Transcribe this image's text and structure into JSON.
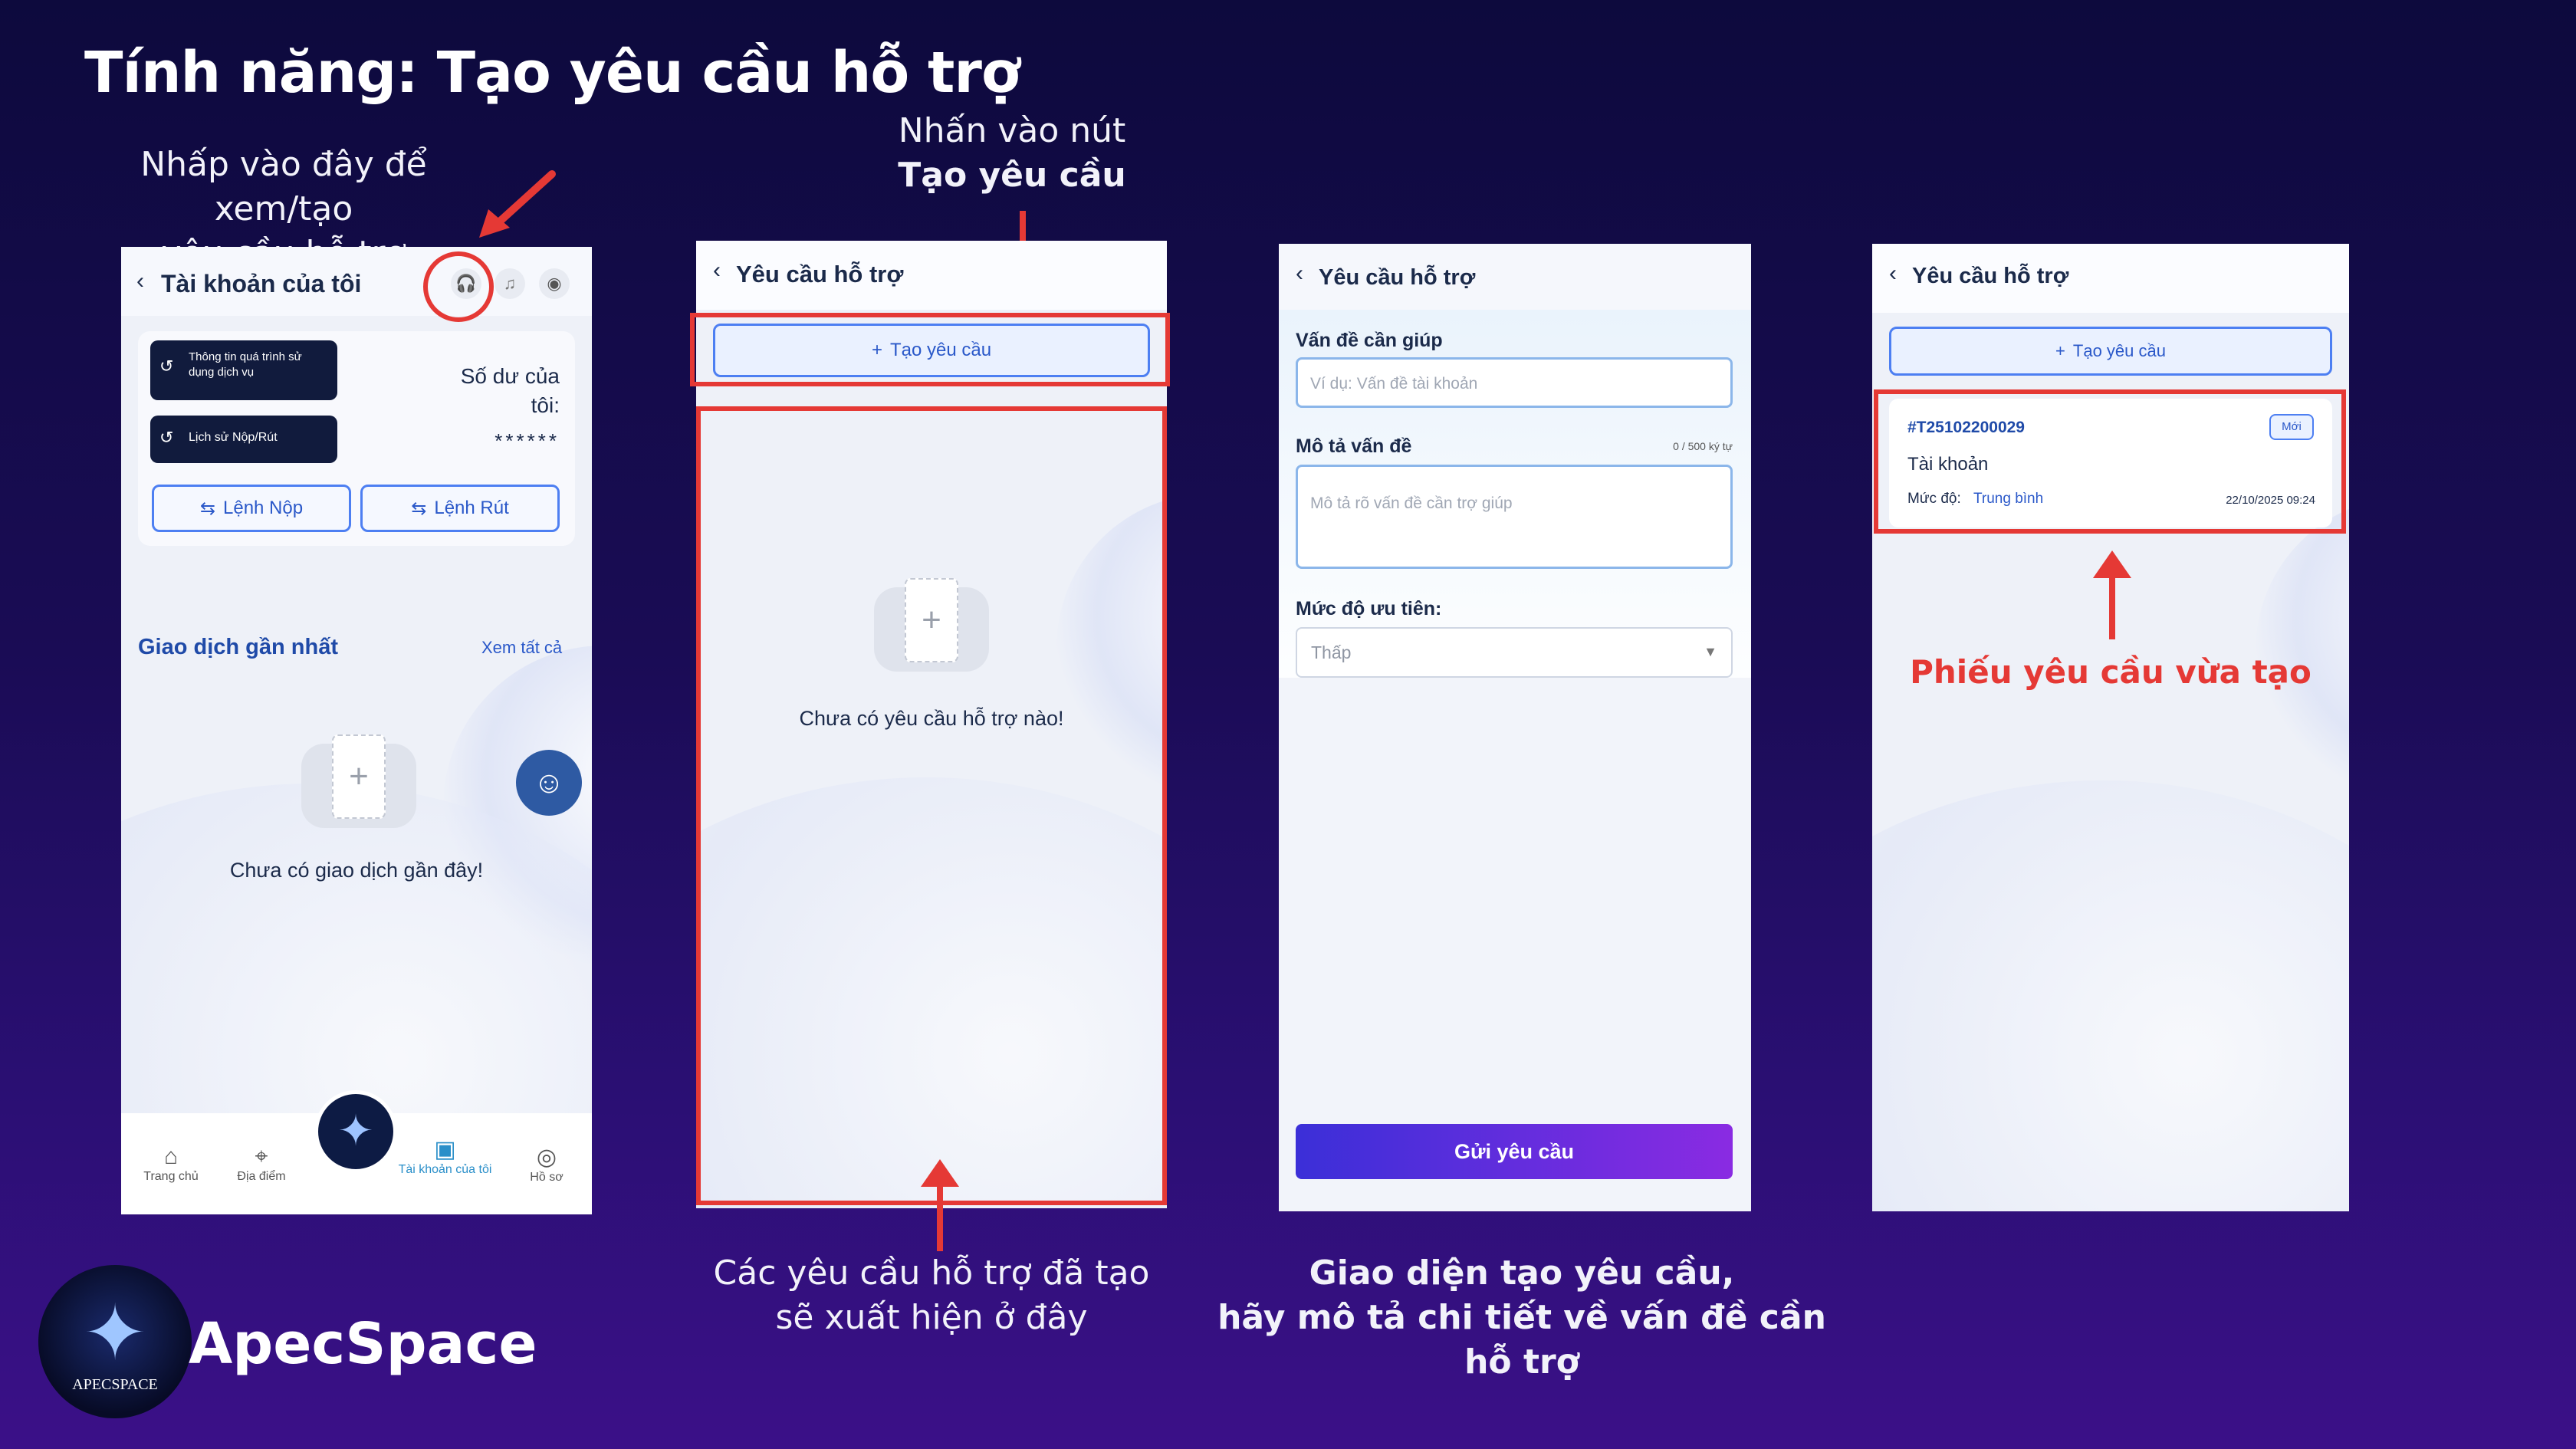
{
  "title": "Tính năng: Tạo yêu cầu hỗ trợ",
  "annotations": {
    "support_hint": [
      "Nhấp vào đây để xem/tạo",
      "yêu cầu hỗ trợ"
    ],
    "create_hint_1": "Nhấn vào nút",
    "create_hint_2": "Tạo yêu cầu",
    "list_hint": [
      "Các yêu cầu hỗ trợ đã tạo",
      "sẽ xuất hiện ở đây"
    ],
    "form_hint": [
      "Giao diện tạo yêu cầu,",
      "hãy mô tả chi tiết về vấn đề cần hỗ trợ"
    ],
    "new_ticket_hint": "Phiếu yêu cầu vừa tạo"
  },
  "brand": {
    "name": "ApecSpace",
    "logo_text": "APECSPACE"
  },
  "screen1": {
    "header": "Tài khoản của tôi",
    "history_btn": "Thông tin quá trình sử dụng dịch vụ",
    "deposit_history_btn": "Lịch sử Nộp/Rút",
    "balance_label": "Số dư của tôi:",
    "balance_value": "******",
    "deposit_btn": "Lệnh Nộp",
    "withdraw_btn": "Lệnh Rút",
    "recent_title": "Giao dịch gần nhất",
    "see_all": "Xem tất cả",
    "empty_text": "Chưa có giao dịch gần đây!",
    "tabs": [
      "Trang chủ",
      "Địa điểm",
      "Tài khoản của tôi",
      "Hồ sơ"
    ]
  },
  "screen2": {
    "header": "Yêu cầu hỗ trợ",
    "create_btn": "Tạo yêu cầu",
    "empty_text": "Chưa có yêu cầu hỗ trợ nào!"
  },
  "screen3": {
    "header": "Yêu cầu hỗ trợ",
    "issue_label": "Vấn đề cần giúp",
    "issue_placeholder": "Ví dụ: Vấn đề tài khoản",
    "desc_label": "Mô tả vấn đề",
    "desc_counter": "0 / 500 ký tự",
    "desc_placeholder": "Mô tả rõ vấn đề cần trợ giúp",
    "priority_label": "Mức độ ưu tiên:",
    "priority_value": "Thấp",
    "submit_btn": "Gửi yêu cầu"
  },
  "screen4": {
    "header": "Yêu cầu hỗ trợ",
    "create_btn": "Tạo yêu cầu",
    "ticket": {
      "id": "#T25102200029",
      "status": "Mới",
      "category": "Tài khoản",
      "level_label": "Mức độ:",
      "level_value": "Trung bình",
      "datetime": "22/10/2025 09:24"
    }
  },
  "colors": {
    "accent_red": "#e53935",
    "blue": "#2a58c9",
    "submit_gradient": [
      "#3b2fd8",
      "#8a2be2"
    ]
  }
}
